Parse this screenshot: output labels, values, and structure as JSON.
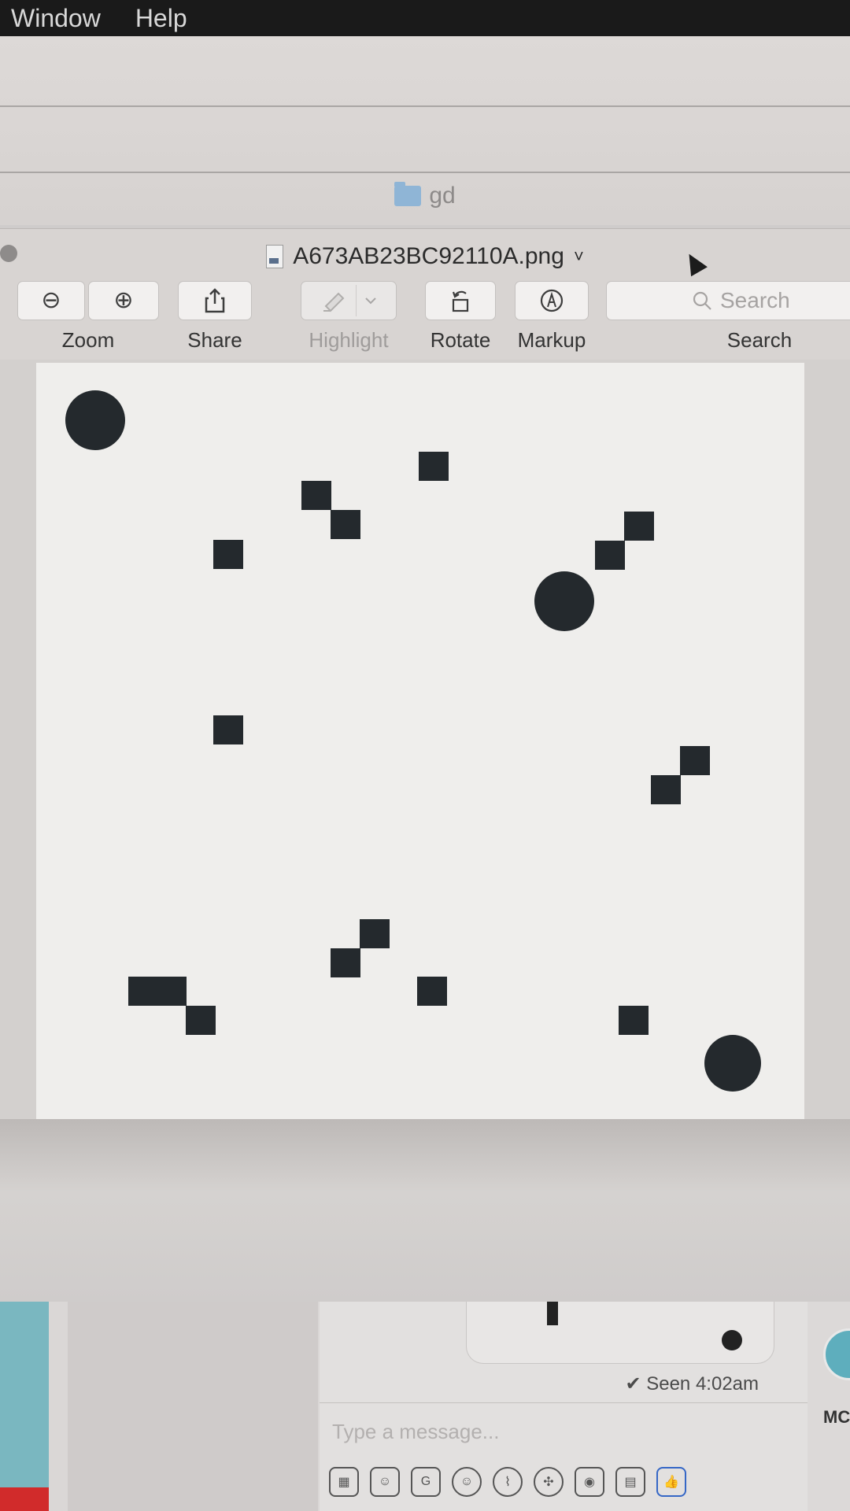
{
  "menubar": {
    "items": [
      "Window",
      "Help"
    ]
  },
  "finder": {
    "folder_title": "gd"
  },
  "preview": {
    "filename": "A673AB23BC92110A.png",
    "title_chevron": "˅",
    "toolbar": {
      "zoom_out_icon": "⊖",
      "zoom_in_icon": "⊕",
      "zoom_label": "Zoom",
      "share_label": "Share",
      "highlight_label": "Highlight",
      "rotate_label": "Rotate",
      "markup_label": "Markup",
      "search_placeholder": "Search",
      "search_label": "Search"
    }
  },
  "messenger": {
    "seen_text": "✔ Seen 4:02am",
    "compose_placeholder": "Type a message...",
    "contact_initials": "MC",
    "icons": [
      "image-icon",
      "sticker-icon",
      "gif-icon",
      "emoji-icon",
      "attachment-icon",
      "game-icon",
      "camera-icon",
      "table-icon",
      "like-icon"
    ]
  },
  "colors": {
    "menubar": "#1a1a1a",
    "shape": "#24292d",
    "page": "#efeeec",
    "like": "#3567c6"
  }
}
